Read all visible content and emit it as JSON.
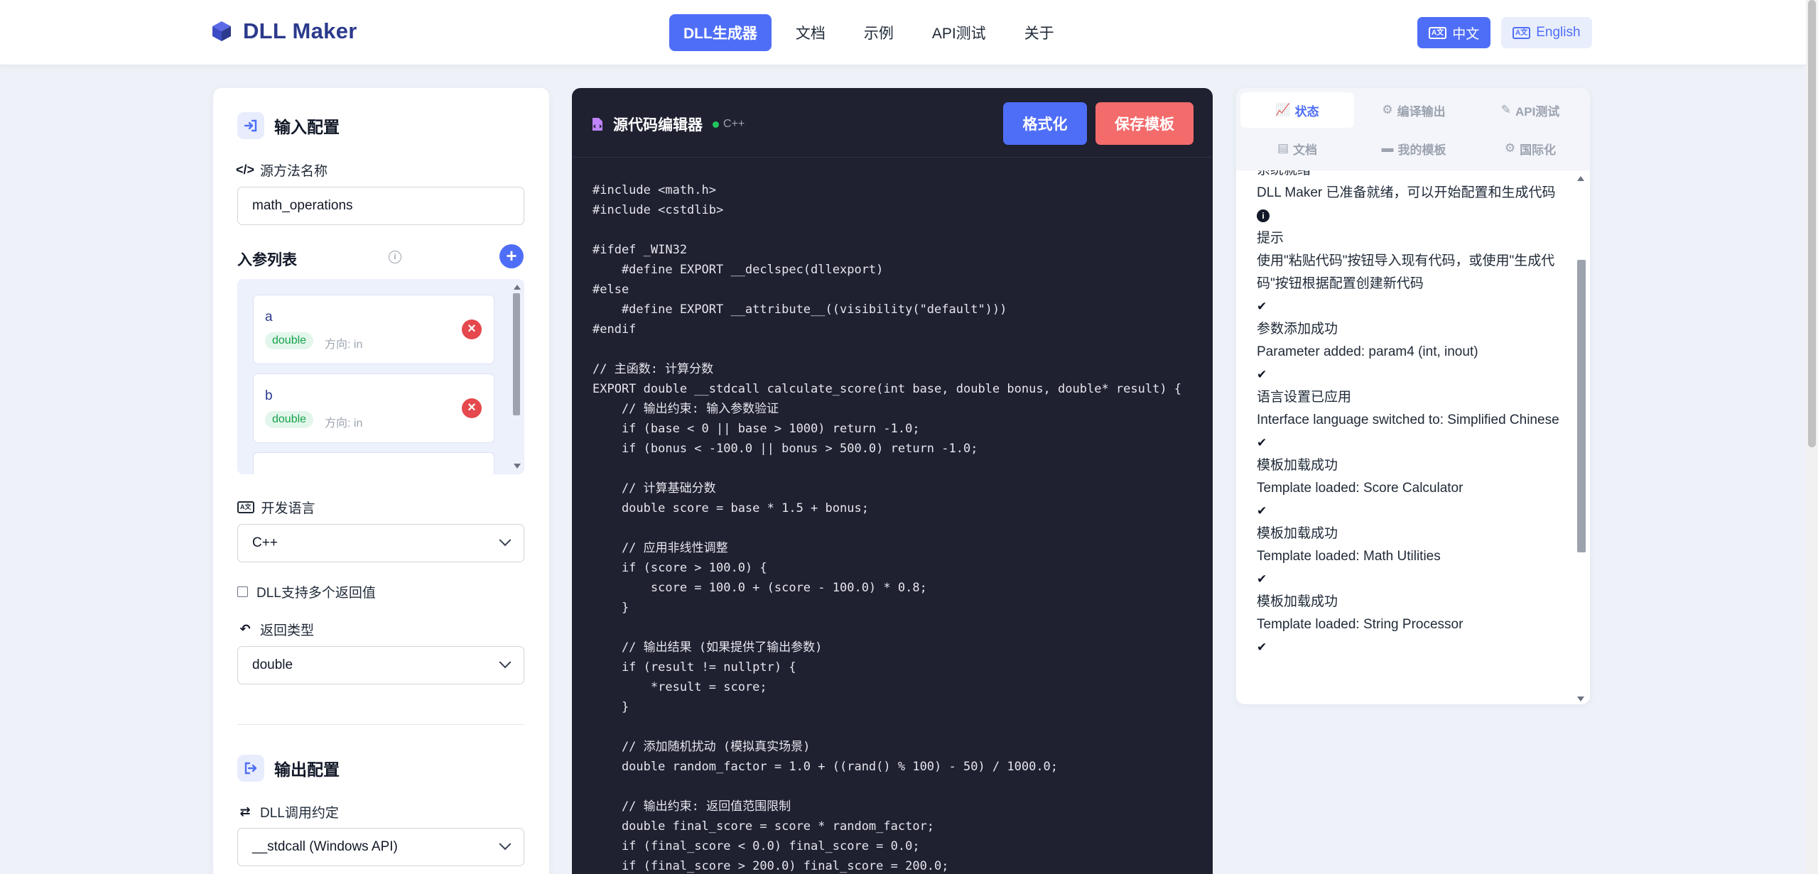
{
  "app": {
    "title": "DLL Maker",
    "icon": "cube-icon",
    "accent_color": "#4f6ef7"
  },
  "nav": {
    "items": [
      {
        "label": "DLL生成器",
        "active": true
      },
      {
        "label": "文档",
        "active": false
      },
      {
        "label": "示例",
        "active": false
      },
      {
        "label": "API测试",
        "active": false
      },
      {
        "label": "关于",
        "active": false
      }
    ]
  },
  "language_switch": {
    "zh_label": "中文",
    "en_label": "English",
    "selected": "中文"
  },
  "input_config": {
    "title": "输入配置",
    "method_name_label": "源方法名称",
    "method_name_value": "math_operations",
    "params_title": "入参列表",
    "params": [
      {
        "name": "a",
        "type": "double",
        "direction": "方向: in"
      },
      {
        "name": "b",
        "type": "double",
        "direction": "方向: in"
      }
    ],
    "dev_language_label": "开发语言",
    "dev_language_value": "C++",
    "multi_return_label": "DLL支持多个返回值",
    "multi_return_checked": false,
    "return_type_label": "返回类型",
    "return_type_value": "double"
  },
  "output_config": {
    "title": "输出配置",
    "calling_convention_label": "DLL调用约定",
    "calling_convention_value": "__stdcall (Windows API)"
  },
  "editor": {
    "title": "源代码编辑器",
    "language_tag": "C++",
    "format_label": "格式化",
    "save_label": "保存模板",
    "code_lines": [
      "#include <math.h>",
      "#include <cstdlib>",
      "",
      "#ifdef _WIN32",
      "    #define EXPORT __declspec(dllexport)",
      "#else",
      "    #define EXPORT __attribute__((visibility(\"default\")))",
      "#endif",
      "",
      "// 主函数: 计算分数",
      "EXPORT double __stdcall calculate_score(int base, double bonus, double* result) {",
      "    // 输出约束: 输入参数验证",
      "    if (base < 0 || base > 1000) return -1.0;",
      "    if (bonus < -100.0 || bonus > 500.0) return -1.0;",
      "",
      "    // 计算基础分数",
      "    double score = base * 1.5 + bonus;",
      "",
      "    // 应用非线性调整",
      "    if (score > 100.0) {",
      "        score = 100.0 + (score - 100.0) * 0.8;",
      "    }",
      "",
      "    // 输出结果 (如果提供了输出参数)",
      "    if (result != nullptr) {",
      "        *result = score;",
      "    }",
      "",
      "    // 添加随机扰动 (模拟真实场景)",
      "    double random_factor = 1.0 + ((rand() % 100) - 50) / 1000.0;",
      "",
      "    // 输出约束: 返回值范围限制",
      "    double final_score = score * random_factor;",
      "    if (final_score < 0.0) final_score = 0.0;",
      "    if (final_score > 200.0) final_score = 200.0;"
    ]
  },
  "status_panel": {
    "tabs": [
      {
        "label": "状态",
        "icon": "chart-line-icon",
        "active": true
      },
      {
        "label": "编译输出",
        "icon": "gears-icon",
        "active": false
      },
      {
        "label": "API测试",
        "icon": "pen-icon",
        "active": false
      },
      {
        "label": "文档",
        "icon": "book-icon",
        "active": false
      },
      {
        "label": "我的模板",
        "icon": "folder-icon",
        "active": false
      },
      {
        "label": "国际化",
        "icon": "gear-icon",
        "active": false
      }
    ],
    "log": [
      {
        "icon": "none",
        "title": "系统就绪",
        "message": "DLL Maker 已准备就绪，可以开始配置和生成代码"
      },
      {
        "icon": "info-icon",
        "title": "提示",
        "message": "使用\"粘贴代码\"按钮导入现有代码，或使用\"生成代码\"按钮根据配置创建新代码"
      },
      {
        "icon": "check-icon",
        "title": "参数添加成功",
        "message": "Parameter added: param4 (int, inout)"
      },
      {
        "icon": "check-icon",
        "title": "语言设置已应用",
        "message": "Interface language switched to: Simplified Chinese"
      },
      {
        "icon": "check-icon",
        "title": "模板加载成功",
        "message": "Template loaded: Score Calculator"
      },
      {
        "icon": "check-icon",
        "title": "模板加载成功",
        "message": "Template loaded: Math Utilities"
      },
      {
        "icon": "check-icon",
        "title": "模板加载成功",
        "message": "Template loaded: String Processor"
      }
    ]
  }
}
